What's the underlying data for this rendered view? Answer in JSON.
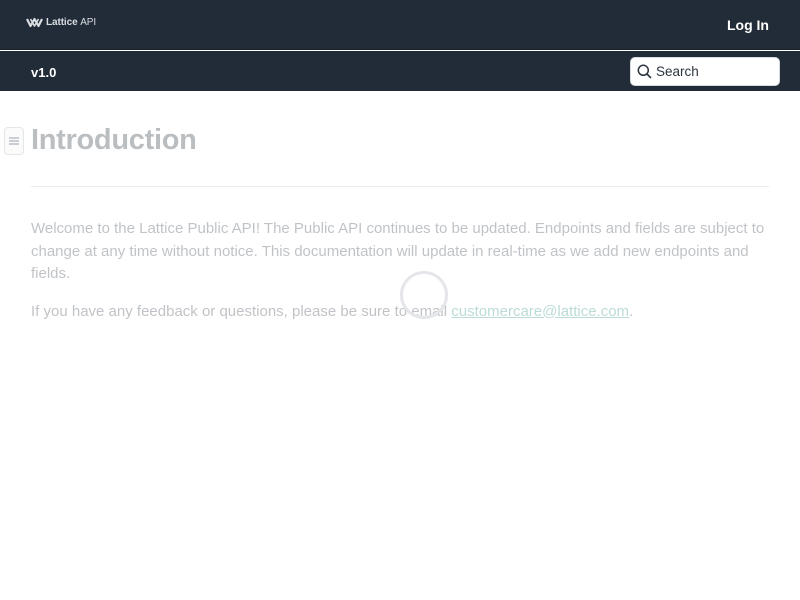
{
  "header": {
    "logo_brand": "Lattice",
    "logo_suffix": "API",
    "login_label": "Log In"
  },
  "subheader": {
    "version": "v1.0",
    "search_placeholder": "Search"
  },
  "content": {
    "title": "Introduction",
    "paragraph_1": "Welcome to the Lattice Public API! The Public API continues to be updated. Endpoints and fields are subject to change at any time without notice. This documentation will update in real-time as we add new endpoints and fields.",
    "paragraph_2_before": "If you have any feedback or questions, please be sure to email ",
    "email": "customercare@lattice.com",
    "paragraph_2_after": "."
  },
  "icons": {
    "logo": "lattice-logo-icon",
    "search": "search-icon",
    "menu": "hamburger-menu-icon",
    "loading": "loading-spinner"
  },
  "colors": {
    "header_bg": "#222c38",
    "link": "#1d8a79",
    "text": "#1f2a36"
  }
}
